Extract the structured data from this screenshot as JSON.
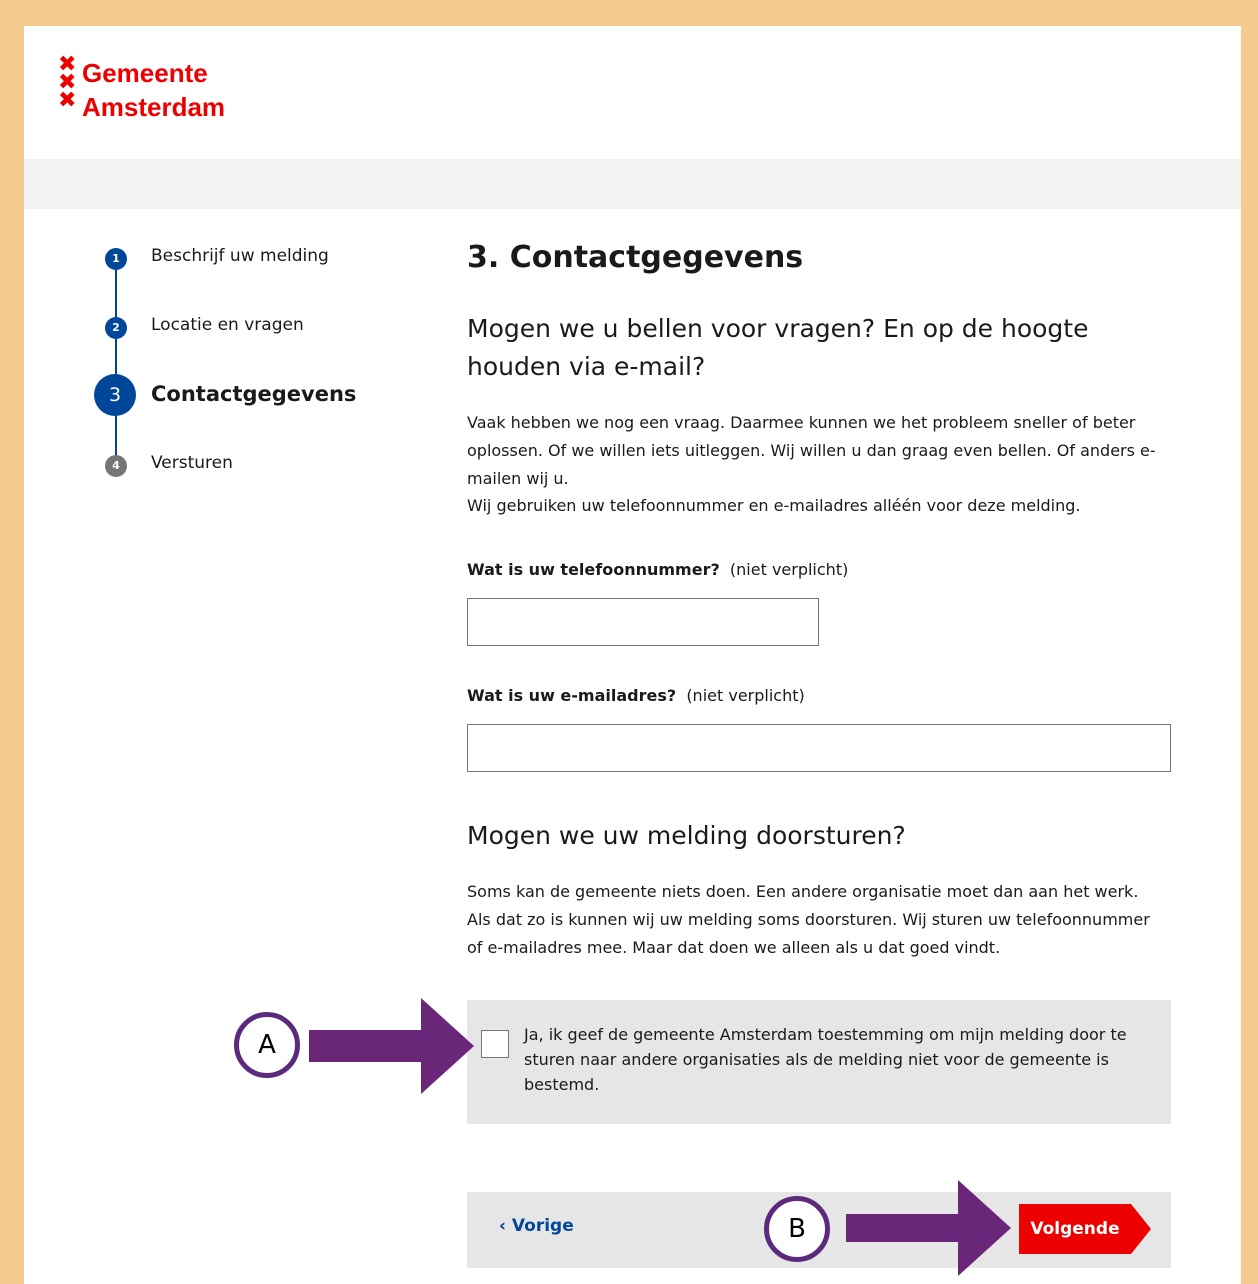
{
  "header": {
    "logo_line1": "Gemeente",
    "logo_line2": "Amsterdam",
    "brand_color": "#ec0000"
  },
  "stepper": {
    "steps": [
      {
        "number": "1",
        "label": "Beschrijf uw melding"
      },
      {
        "number": "2",
        "label": "Locatie en vragen"
      },
      {
        "number": "3",
        "label": "Contactgegevens"
      },
      {
        "number": "4",
        "label": "Versturen"
      }
    ],
    "active_color": "#004699",
    "inactive_color": "#767676"
  },
  "main": {
    "title": "3. Contactgegevens",
    "question1_heading": "Mogen we u bellen voor vragen? En op de hoogte houden via e-mail?",
    "intro_text": "Vaak hebben we nog een vraag. Daarmee kunnen we het probleem sneller of beter oplossen. Of we willen iets uitleggen. Wij willen u dan graag even bellen. Of anders e-mailen wij u.",
    "privacy_text": "Wij gebruiken uw telefoonnummer en e-mailadres alléén voor deze melding.",
    "phone_label": "Wat is uw telefoonnummer?",
    "phone_optional": "(niet verplicht)",
    "phone_value": "",
    "email_label": "Wat is uw e-mailadres?",
    "email_optional": "(niet verplicht)",
    "email_value": "",
    "question2_heading": "Mogen we uw melding doorsturen?",
    "forward_text": "Soms kan de gemeente niets doen. Een andere organisatie moet dan aan het werk. Als dat zo is kunnen wij uw melding soms doorsturen. Wij sturen uw telefoonnummer of e-mailadres mee. Maar dat doen we alleen als u dat goed vindt.",
    "consent_text": "Ja, ik geef de gemeente Amsterdam toestemming om mijn melding door te sturen naar andere organisaties als de melding niet voor de gemeente is bestemd.",
    "prev_label": "‹ Vorige",
    "next_label": "Volgende"
  },
  "annotations": {
    "a_label": "A",
    "b_label": "B",
    "arrow_color": "#6a2678"
  }
}
